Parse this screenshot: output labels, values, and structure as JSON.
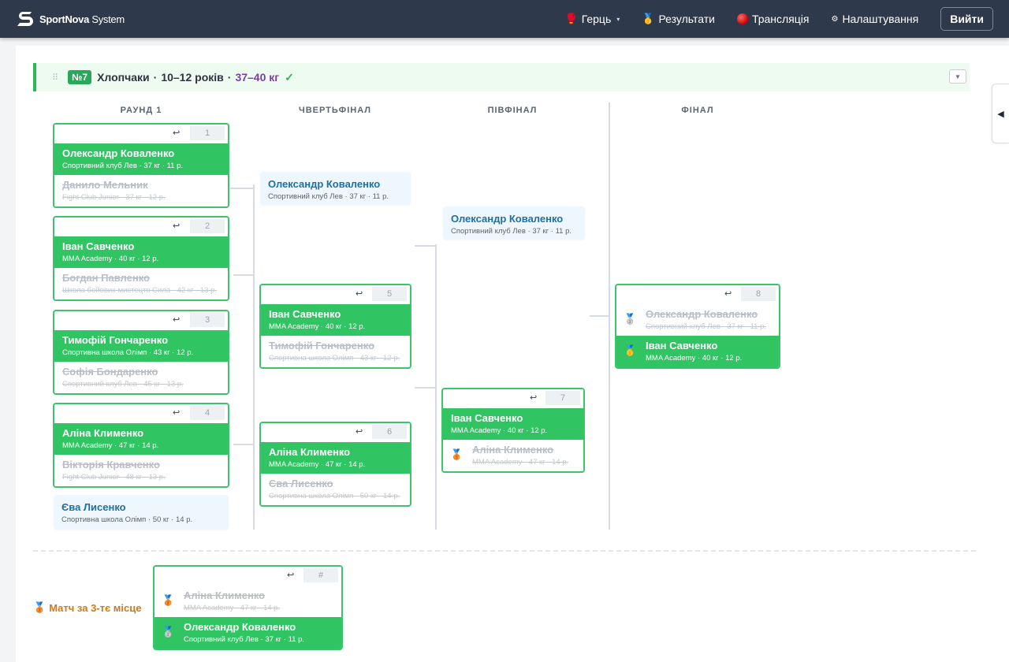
{
  "brand": {
    "name_bold": "SportNova",
    "name_light": " System"
  },
  "nav": {
    "items": [
      {
        "icon": "🥊",
        "label": "Герць",
        "caret": "▾"
      },
      {
        "icon": "🥇",
        "label": "Результати"
      },
      {
        "icon": "",
        "label": "Трансляція"
      },
      {
        "icon": "⚙",
        "label": "Налаштування"
      }
    ],
    "logout": "Вийти"
  },
  "category": {
    "drag": "⠿",
    "badge": "№7",
    "name": "Хлопчаки",
    "dot": "·",
    "age": "10–12 років",
    "weight": "37–40 кг",
    "check": "✓",
    "collapse": "▼",
    "side_tab": "◀"
  },
  "rounds": [
    "РАУНД 1",
    "ЧВЕРТЬФІНАЛ",
    "ПІВФІНАЛ",
    "ФІНАЛ"
  ],
  "undo_icon": "↩",
  "matches": {
    "m1": {
      "num": "1",
      "winner": {
        "name": "Олександр Коваленко",
        "info": "Спортивний клуб Лев · 37 кг · 11 р."
      },
      "loser": {
        "name": "Данило Мельник",
        "info": "Fight Club Junior · 37 кг · 12 р."
      }
    },
    "m2": {
      "num": "2",
      "winner": {
        "name": "Іван Савченко",
        "info": "MMA Academy · 40 кг · 12 р."
      },
      "loser": {
        "name": "Богдан Павленко",
        "info": "Школа бойових мистецтв Сила · 42 кг · 13 р."
      }
    },
    "m3": {
      "num": "3",
      "winner": {
        "name": "Тимофій Гончаренко",
        "info": "Спортивна школа Олімп · 43 кг · 12 р."
      },
      "loser": {
        "name": "Софія Бондаренко",
        "info": "Спортивний клуб Лев · 45 кг · 13 р."
      }
    },
    "m4": {
      "num": "4",
      "winner": {
        "name": "Аліна Клименко",
        "info": "MMA Academy · 47 кг · 14 р."
      },
      "loser": {
        "name": "Вікторія Кравченко",
        "info": "Fight Club Junior · 48 кг · 13 р."
      }
    },
    "m5": {
      "num": "5",
      "winner": {
        "name": "Іван Савченко",
        "info": "MMA Academy · 40 кг · 12 р."
      },
      "loser": {
        "name": "Тимофій Гончаренко",
        "info": "Спортивна школа Олімп · 43 кг · 12 р."
      }
    },
    "m6": {
      "num": "6",
      "winner": {
        "name": "Аліна Клименко",
        "info": "MMA Academy · 47 кг · 14 р."
      },
      "loser": {
        "name": "Єва Лисенко",
        "info": "Спортивна школа Олімп · 50 кг · 14 р."
      }
    },
    "m7": {
      "num": "7",
      "winner": {
        "name": "Іван Савченко",
        "info": "MMA Academy · 40 кг · 12 р."
      },
      "loser": {
        "name": "Аліна Клименко",
        "info": "MMA Academy · 47 кг · 14 р.",
        "medal": "🥉"
      }
    },
    "m8": {
      "num": "8",
      "loser": {
        "name": "Олександр Коваленко",
        "info": "Спортивний клуб Лев · 37 кг · 11 р.",
        "medal": "🥈"
      },
      "winner": {
        "name": "Іван Савченко",
        "info": "MMA Academy · 40 кг · 12 р.",
        "medal": "🥇"
      }
    },
    "third": {
      "num": "#",
      "loser": {
        "name": "Аліна Клименко",
        "info": "MMA Academy · 47 кг · 14 р.",
        "medal": "🥉"
      },
      "winner": {
        "name": "Олександр Коваленко",
        "info": "Спортивний клуб Лев · 37 кг · 11 р.",
        "medal": "🥈"
      }
    }
  },
  "advances": {
    "bye_r1": {
      "name": "Єва Лисенко",
      "info": "Спортивна школа Олімп · 50 кг · 14 р."
    },
    "qf_bye": {
      "name": "Олександр Коваленко",
      "info": "Спортивний клуб Лев · 37 кг · 11 р."
    },
    "sf_bye": {
      "name": "Олександр Коваленко",
      "info": "Спортивний клуб Лев · 37 кг · 11 р."
    }
  },
  "third_place": {
    "icon": "🥉",
    "label": "Матч за 3-тє місце"
  }
}
